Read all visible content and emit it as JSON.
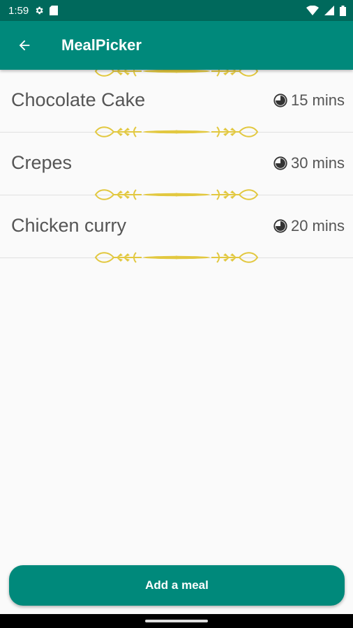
{
  "status": {
    "time": "1:59",
    "icons": [
      "gear-icon",
      "sim-card-icon",
      "wifi-icon",
      "signal-icon",
      "battery-icon"
    ]
  },
  "app_bar": {
    "title": "MealPicker",
    "back_icon": "arrow-left-icon"
  },
  "meals": [
    {
      "name": "Chocolate Cake",
      "time": "15 mins"
    },
    {
      "name": "Crepes",
      "time": "30 mins"
    },
    {
      "name": "Chicken curry",
      "time": "20 mins"
    }
  ],
  "add_button": {
    "label": "Add a meal"
  },
  "colors": {
    "primary": "#00897b",
    "primary_dark": "#00695c",
    "ornament": "#e2c840"
  }
}
